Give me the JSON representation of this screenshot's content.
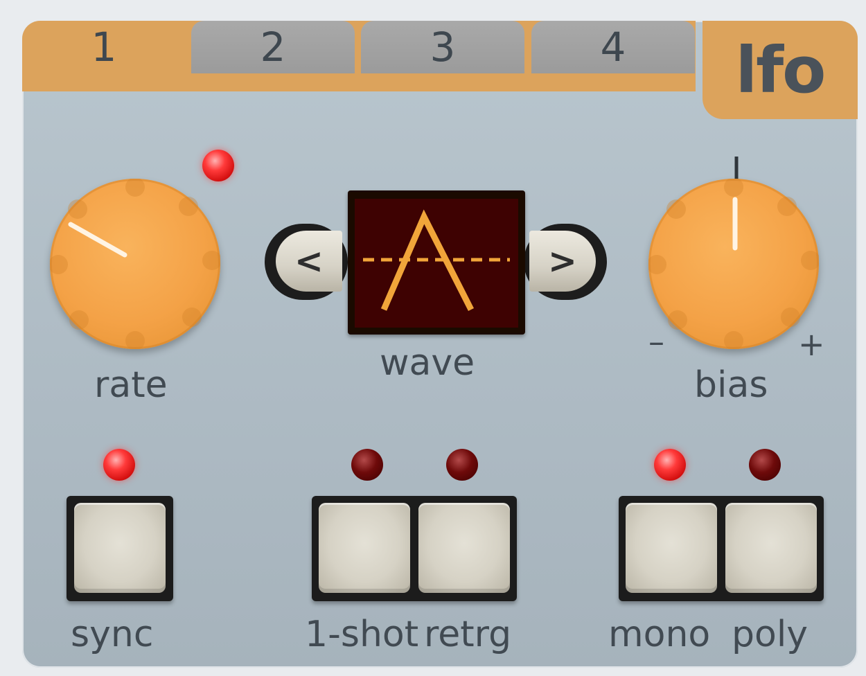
{
  "tabs": [
    {
      "label": "1",
      "active": true
    },
    {
      "label": "2",
      "active": false
    },
    {
      "label": "3",
      "active": false
    },
    {
      "label": "4",
      "active": false
    }
  ],
  "section_title": "lfo",
  "knobs": {
    "rate": {
      "label": "rate"
    },
    "bias": {
      "label": "bias",
      "min_label": "–",
      "max_label": "+"
    }
  },
  "wave": {
    "label": "wave",
    "prev_label": "<",
    "next_label": ">",
    "shape": "triangle"
  },
  "buttons": {
    "sync": {
      "label": "sync",
      "led": "on"
    },
    "one_shot": {
      "label": "1-shot",
      "led": "off"
    },
    "retrig": {
      "label": "retrg",
      "led": "off"
    },
    "mono": {
      "label": "mono",
      "led": "on"
    },
    "poly": {
      "label": "poly",
      "led": "off"
    }
  },
  "rate_indicator_led": "on",
  "colors": {
    "accent": "#dca35c",
    "knob": "#f4a247",
    "panel": "#b4c1ca",
    "led_on": "#ff2a2a",
    "led_off": "#5a0505",
    "wave_trace": "#f1a53a"
  }
}
